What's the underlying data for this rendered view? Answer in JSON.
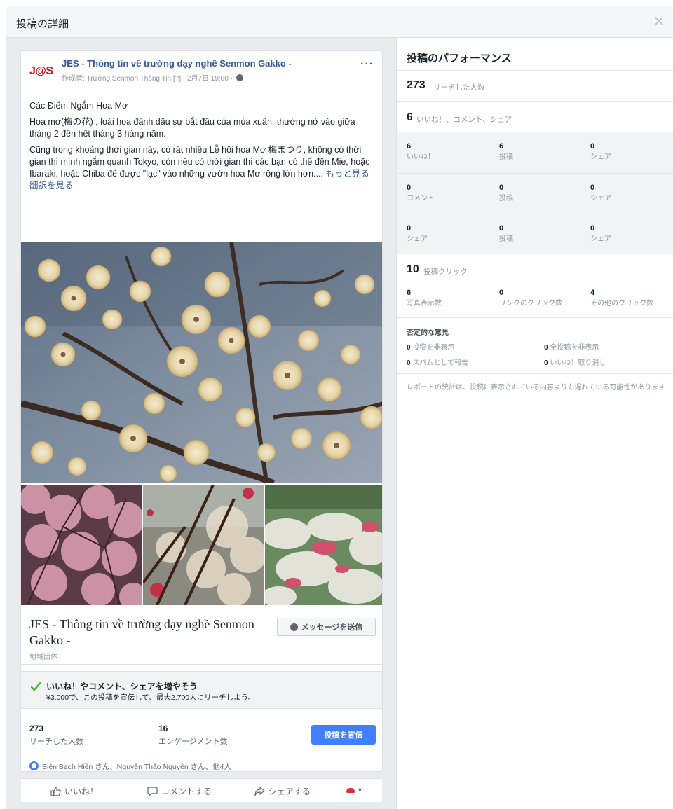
{
  "dialog": {
    "title": "投稿の詳細"
  },
  "post": {
    "page_name": "JES - Thông tin về trường dạy nghề Senmon Gakko -",
    "meta": "作成者: Trường Senmon Thông Tin [?] · 2月7日 19:00 ·",
    "logo_text": "J@S",
    "paragraphs": [
      "Các Điểm Ngắm Hoa Mơ",
      "Hoa mơ(梅の花) , loài hoa đánh dấu sự bắt đầu của mùa xuân, thường nở vào giữa tháng 2 đến hết tháng 3 hàng năm.",
      "Cũng trong khoảng thời gian này, có rất nhiều Lễ hội hoa Mơ 梅まつり, không có thời gian thì mình ngắm quanh Tokyo, còn nếu có thời gian thì các bạn có thể đến Mie, hoặc Ibaraki, hoặc Chiba để được \"lạc\" vào những vườn hoa Mơ rộng lớn hơn...."
    ],
    "see_more": "もっと見る",
    "translate": "翻訳を見る"
  },
  "attachment": {
    "title": "JES - Thông tin về trường dạy nghề Senmon Gakko -",
    "subtitle": "地域団体",
    "message_button": "メッセージを送信"
  },
  "boost": {
    "title": "いいね！やコメント、シェアを増やそう",
    "desc": "¥3,000で、この投稿を宣伝して、最大2,700人にリーチしよう。"
  },
  "stats": {
    "reach_value": "273",
    "reach_label": "リーチした人数",
    "engagement_value": "16",
    "engagement_label": "エンゲージメント数",
    "boost_button": "投稿を宣伝"
  },
  "reactors_text": "Biện Bạch Hiền さん、Nguyễn Thảo Nguyên さん、他4人",
  "actions": {
    "like": "いいね！",
    "comment": "コメントする",
    "share": "シェアする"
  },
  "performance": {
    "title": "投稿のパフォーマンス",
    "reach_value": "273",
    "reach_label": "リーチした人数",
    "engagement_value": "6",
    "engagement_label": "いいね！、コメント、シェア",
    "grid": [
      [
        {
          "v": "6",
          "l": "いいね！"
        },
        {
          "v": "6",
          "l": "投稿"
        },
        {
          "v": "0",
          "l": "シェア"
        }
      ],
      [
        {
          "v": "0",
          "l": "コメント"
        },
        {
          "v": "0",
          "l": "投稿"
        },
        {
          "v": "0",
          "l": "シェア"
        }
      ],
      [
        {
          "v": "0",
          "l": "シェア"
        },
        {
          "v": "0",
          "l": "投稿"
        },
        {
          "v": "0",
          "l": "シェア"
        }
      ]
    ],
    "clicks_value": "10",
    "clicks_label": "投稿クリック",
    "click_breakdown": [
      {
        "v": "6",
        "l": "写真表示数"
      },
      {
        "v": "0",
        "l": "リンクのクリック数"
      },
      {
        "v": "4",
        "l": "その他のクリック数"
      }
    ],
    "negative_title": "否定的な意見",
    "negative": [
      {
        "v": "0",
        "l": "投稿を非表示"
      },
      {
        "v": "0",
        "l": "全投稿を非表示"
      },
      {
        "v": "0",
        "l": "スパムとして報告"
      },
      {
        "v": "0",
        "l": "いいね！取り消し"
      }
    ],
    "note": "レポートの統計は、投稿に表示されている内容よりも遅れている可能性があります"
  },
  "colors": {
    "link": "#365899",
    "primary": "#4080ff",
    "logo_red": "#d4121a",
    "check_green": "#42b72a"
  }
}
